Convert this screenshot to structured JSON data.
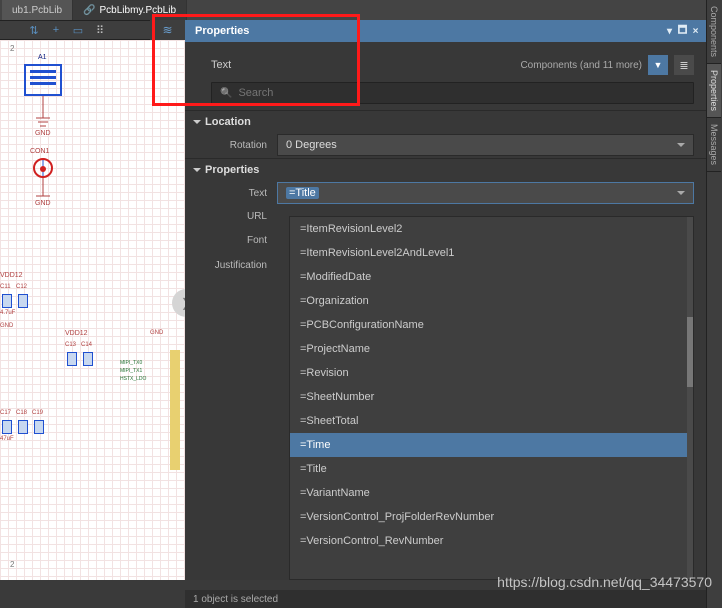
{
  "tabs": {
    "doc1": "ub1.PcbLib",
    "doc2": "PcbLibmy.PcbLib"
  },
  "toolbar": {
    "filter_icon": "⇅",
    "plus_icon": "+",
    "rect_icon": "▭",
    "grip_icon": "⠿",
    "slider_icon": "≋"
  },
  "side_rail": {
    "t1": "Components",
    "t2": "Properties",
    "t3": "Messages"
  },
  "panel": {
    "title": "Properties",
    "header_icons": {
      "min": "▾",
      "max": "🗖",
      "close": "×"
    },
    "sub_title": "Text",
    "hint_text": "Components (and 11 more)",
    "filter_icon": "▼",
    "list_icon": "≣",
    "search_placeholder": "Search",
    "search_icon": "🔍",
    "section_location": "Location",
    "rotation_label": "Rotation",
    "rotation_value": "0 Degrees",
    "section_properties": "Properties",
    "text_label": "Text",
    "text_value": "=Title",
    "url_label": "URL",
    "font_label": "Font",
    "justification_label": "Justification"
  },
  "dropdown": {
    "items": [
      "=ItemRevisionLevel2",
      "=ItemRevisionLevel2AndLevel1",
      "=ModifiedDate",
      "=Organization",
      "=PCBConfigurationName",
      "=ProjectName",
      "=Revision",
      "=SheetNumber",
      "=SheetTotal",
      "=Time",
      "=Title",
      "=VariantName",
      "=VersionControl_ProjFolderRevNumber",
      "=VersionControl_RevNumber"
    ],
    "highlight_index": 9
  },
  "schematic": {
    "A1": "A1",
    "GND": "GND",
    "CON1": "CON1",
    "VDD12": "VDD12",
    "C11": "C11",
    "C12": "C12",
    "C13": "C13",
    "C14": "C14",
    "C17": "C17",
    "C18": "C18",
    "C19": "C19",
    "val1": "4.7uF",
    "val2": "47uF",
    "col2": "2"
  },
  "status": {
    "text": "1 object is selected"
  },
  "watermark": "https://blog.csdn.net/qq_34473570"
}
